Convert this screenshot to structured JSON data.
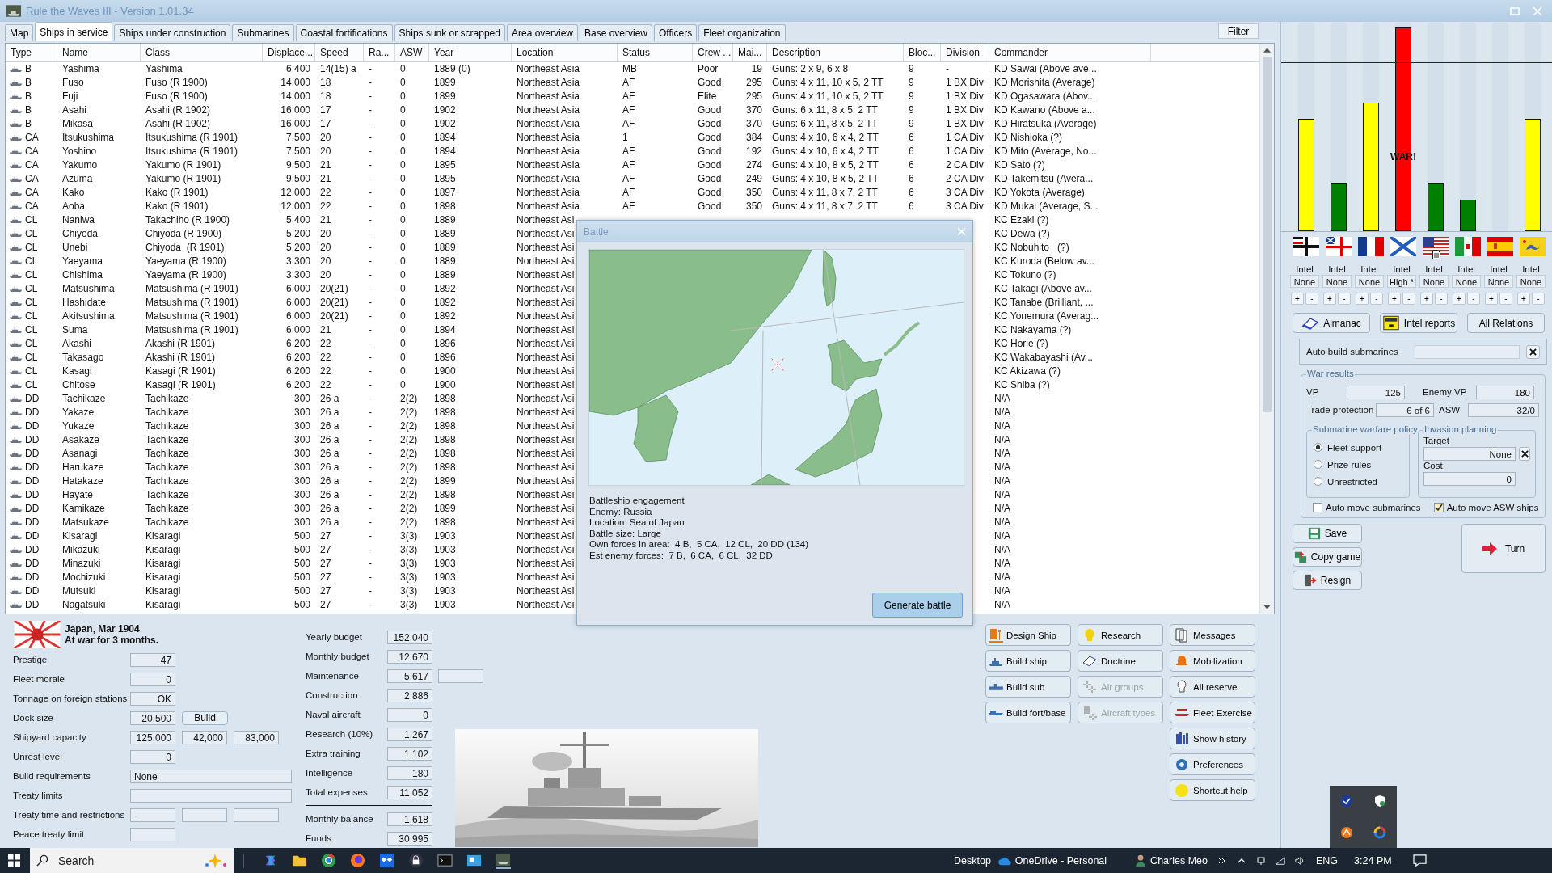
{
  "window": {
    "title": "Rule the Waves III - Version 1.01.34"
  },
  "tabs": [
    {
      "label": "Map",
      "selected": false
    },
    {
      "label": "Ships in service",
      "selected": true
    },
    {
      "label": "Ships under construction",
      "selected": false
    },
    {
      "label": "Submarines",
      "selected": false
    },
    {
      "label": "Coastal fortifications",
      "selected": false
    },
    {
      "label": "Ships sunk or scrapped",
      "selected": false
    },
    {
      "label": "Area overview",
      "selected": false
    },
    {
      "label": "Base overview",
      "selected": false
    },
    {
      "label": "Officers",
      "selected": false
    },
    {
      "label": "Fleet organization",
      "selected": false
    }
  ],
  "filter_button": "Filter",
  "table": {
    "columns": [
      "Type",
      "Name",
      "Class",
      "Displace...",
      "Speed",
      "Ra...",
      "ASW",
      "Year",
      "Location",
      "Status",
      "Crew ...",
      "Mai...",
      "Description",
      "Bloc...",
      "Division",
      "Commander"
    ],
    "rows": [
      {
        "type": "B",
        "name": "Yashima",
        "class": "Yashima",
        "displace": "6,400",
        "speed": "14(15) a",
        "ra": "-",
        "asw": "0",
        "year": "1889 (0)",
        "location": "Northeast Asia",
        "status": "MB",
        "crew": "Poor",
        "mai": "19",
        "description": "Guns: 2 x 9, 6 x 8",
        "bloc": "9",
        "division": "-",
        "commander": "KD Sawai (Above ave..."
      },
      {
        "type": "B",
        "name": "Fuso",
        "class": "Fuso (R 1900)",
        "displace": "14,000",
        "speed": "18",
        "ra": "-",
        "asw": "0",
        "year": "1899",
        "location": "Northeast Asia",
        "status": "AF",
        "crew": "Good",
        "mai": "295",
        "description": "Guns: 4 x 11, 10 x 5, 2 TT",
        "bloc": "9",
        "division": "1 BX Div",
        "commander": "KD Morishita (Average)"
      },
      {
        "type": "B",
        "name": "Fuji",
        "class": "Fuso (R 1900)",
        "displace": "14,000",
        "speed": "18",
        "ra": "-",
        "asw": "0",
        "year": "1899",
        "location": "Northeast Asia",
        "status": "AF",
        "crew": "Elite",
        "mai": "295",
        "description": "Guns: 4 x 11, 10 x 5, 2 TT",
        "bloc": "9",
        "division": "1 BX Div",
        "commander": "KD Ogasawara (Abov..."
      },
      {
        "type": "B",
        "name": "Asahi",
        "class": "Asahi (R 1902)",
        "displace": "16,000",
        "speed": "17",
        "ra": "-",
        "asw": "0",
        "year": "1902",
        "location": "Northeast Asia",
        "status": "AF",
        "crew": "Good",
        "mai": "370",
        "description": "Guns: 6 x 11, 8 x 5, 2 TT",
        "bloc": "9",
        "division": "1 BX Div",
        "commander": "KD Kawano (Above a..."
      },
      {
        "type": "B",
        "name": "Mikasa",
        "class": "Asahi (R 1902)",
        "displace": "16,000",
        "speed": "17",
        "ra": "-",
        "asw": "0",
        "year": "1902",
        "location": "Northeast Asia",
        "status": "AF",
        "crew": "Good",
        "mai": "370",
        "description": "Guns: 6 x 11, 8 x 5, 2 TT",
        "bloc": "9",
        "division": "1 BX Div",
        "commander": "KD Hiratsuka (Average)"
      },
      {
        "type": "CA",
        "name": "Itsukushima",
        "class": "Itsukushima (R 1901)",
        "displace": "7,500",
        "speed": "20",
        "ra": "-",
        "asw": "0",
        "year": "1894",
        "location": "Northeast Asia",
        "status": "1",
        "crew": "Good",
        "mai": "384",
        "description": "Guns: 4 x 10, 6 x 4, 2 TT",
        "bloc": "6",
        "division": "1 CA Div",
        "commander": "KD Nishioka (?)"
      },
      {
        "type": "CA",
        "name": "Yoshino",
        "class": "Itsukushima (R 1901)",
        "displace": "7,500",
        "speed": "20",
        "ra": "-",
        "asw": "0",
        "year": "1894",
        "location": "Northeast Asia",
        "status": "AF",
        "crew": "Good",
        "mai": "192",
        "description": "Guns: 4 x 10, 6 x 4, 2 TT",
        "bloc": "6",
        "division": "1 CA Div",
        "commander": "KD Mito (Average, No..."
      },
      {
        "type": "CA",
        "name": "Yakumo",
        "class": "Yakumo (R 1901)",
        "displace": "9,500",
        "speed": "21",
        "ra": "-",
        "asw": "0",
        "year": "1895",
        "location": "Northeast Asia",
        "status": "AF",
        "crew": "Good",
        "mai": "274",
        "description": "Guns: 4 x 10, 8 x 5, 2 TT",
        "bloc": "6",
        "division": "2 CA Div",
        "commander": "KD Sato (?)"
      },
      {
        "type": "CA",
        "name": "Azuma",
        "class": "Yakumo (R 1901)",
        "displace": "9,500",
        "speed": "21",
        "ra": "-",
        "asw": "0",
        "year": "1895",
        "location": "Northeast Asia",
        "status": "AF",
        "crew": "Good",
        "mai": "249",
        "description": "Guns: 4 x 10, 8 x 5, 2 TT",
        "bloc": "6",
        "division": "2 CA Div",
        "commander": "KD Takemitsu (Avera..."
      },
      {
        "type": "CA",
        "name": "Kako",
        "class": "Kako (R 1901)",
        "displace": "12,000",
        "speed": "22",
        "ra": "-",
        "asw": "0",
        "year": "1897",
        "location": "Northeast Asia",
        "status": "AF",
        "crew": "Good",
        "mai": "350",
        "description": "Guns: 4 x 11, 8 x 7, 2 TT",
        "bloc": "6",
        "division": "3 CA Div",
        "commander": "KD Yokota (Average)"
      },
      {
        "type": "CA",
        "name": "Aoba",
        "class": "Kako (R 1901)",
        "displace": "12,000",
        "speed": "22",
        "ra": "-",
        "asw": "0",
        "year": "1898",
        "location": "Northeast Asia",
        "status": "AF",
        "crew": "Good",
        "mai": "350",
        "description": "Guns: 4 x 11, 8 x 7, 2 TT",
        "bloc": "6",
        "division": "3 CA Div",
        "commander": "KD Mukai (Average, S..."
      },
      {
        "type": "CL",
        "name": "Naniwa",
        "class": "Takachiho (R 1900)",
        "displace": "5,400",
        "speed": "21",
        "ra": "-",
        "asw": "0",
        "year": "1889",
        "location": "Northeast Asi",
        "commander": "KC Ezaki (?)"
      },
      {
        "type": "CL",
        "name": "Chiyoda",
        "class": "Chiyoda (R 1900)",
        "displace": "5,200",
        "speed": "20",
        "ra": "-",
        "asw": "0",
        "year": "1889",
        "location": "Northeast Asi",
        "commander": "KC Dewa (?)"
      },
      {
        "type": "CL",
        "name": "Unebi",
        "class": "Chiyoda  (R 1901)",
        "displace": "5,200",
        "speed": "20",
        "ra": "-",
        "asw": "0",
        "year": "1889",
        "location": "Northeast Asi",
        "commander": "KC Nobuhito   (?)"
      },
      {
        "type": "CL",
        "name": "Yaeyama",
        "class": "Yaeyama (R 1900)",
        "displace": "3,300",
        "speed": "20",
        "ra": "-",
        "asw": "0",
        "year": "1889",
        "location": "Northeast Asi",
        "commander": "KC Kuroda (Below av..."
      },
      {
        "type": "CL",
        "name": "Chishima",
        "class": "Yaeyama (R 1900)",
        "displace": "3,300",
        "speed": "20",
        "ra": "-",
        "asw": "0",
        "year": "1889",
        "location": "Northeast Asi",
        "commander": "KC Tokuno (?)"
      },
      {
        "type": "CL",
        "name": "Matsushima",
        "class": "Matsushima (R 1901)",
        "displace": "6,000",
        "speed": "20(21)",
        "ra": "-",
        "asw": "0",
        "year": "1892",
        "location": "Northeast Asi",
        "commander": "KC Takagi (Above av..."
      },
      {
        "type": "CL",
        "name": "Hashidate",
        "class": "Matsushima (R 1901)",
        "displace": "6,000",
        "speed": "20(21)",
        "ra": "-",
        "asw": "0",
        "year": "1892",
        "location": "Northeast Asi",
        "commander": "KC Tanabe (Brilliant, ..."
      },
      {
        "type": "CL",
        "name": "Akitsushima",
        "class": "Matsushima (R 1901)",
        "displace": "6,000",
        "speed": "20(21)",
        "ra": "-",
        "asw": "0",
        "year": "1892",
        "location": "Northeast Asi",
        "commander": "KC Yonemura (Averag..."
      },
      {
        "type": "CL",
        "name": "Suma",
        "class": "Matsushima (R 1901)",
        "displace": "6,000",
        "speed": "21",
        "ra": "-",
        "asw": "0",
        "year": "1894",
        "location": "Northeast Asi",
        "commander": "KC Nakayama (?)"
      },
      {
        "type": "CL",
        "name": "Akashi",
        "class": "Akashi (R 1901)",
        "displace": "6,200",
        "speed": "22",
        "ra": "-",
        "asw": "0",
        "year": "1896",
        "location": "Northeast Asi",
        "commander": "KC Horie (?)"
      },
      {
        "type": "CL",
        "name": "Takasago",
        "class": "Akashi (R 1901)",
        "displace": "6,200",
        "speed": "22",
        "ra": "-",
        "asw": "0",
        "year": "1896",
        "location": "Northeast Asi",
        "commander": "KC Wakabayashi (Av..."
      },
      {
        "type": "CL",
        "name": "Kasagi",
        "class": "Kasagi (R 1901)",
        "displace": "6,200",
        "speed": "22",
        "ra": "-",
        "asw": "0",
        "year": "1900",
        "location": "Northeast Asi",
        "commander": "KC Akizawa (?)"
      },
      {
        "type": "CL",
        "name": "Chitose",
        "class": "Kasagi (R 1901)",
        "displace": "6,200",
        "speed": "22",
        "ra": "-",
        "asw": "0",
        "year": "1900",
        "location": "Northeast Asi",
        "commander": "KC Shiba (?)"
      },
      {
        "type": "DD",
        "name": "Tachikaze",
        "class": "Tachikaze",
        "displace": "300",
        "speed": "26 a",
        "ra": "-",
        "asw": "2(2)",
        "year": "1898",
        "location": "Northeast Asi",
        "commander": "N/A"
      },
      {
        "type": "DD",
        "name": "Yakaze",
        "class": "Tachikaze",
        "displace": "300",
        "speed": "26 a",
        "ra": "-",
        "asw": "2(2)",
        "year": "1898",
        "location": "Northeast Asi",
        "commander": "N/A"
      },
      {
        "type": "DD",
        "name": "Yukaze",
        "class": "Tachikaze",
        "displace": "300",
        "speed": "26 a",
        "ra": "-",
        "asw": "2(2)",
        "year": "1898",
        "location": "Northeast Asi",
        "commander": "N/A"
      },
      {
        "type": "DD",
        "name": "Asakaze",
        "class": "Tachikaze",
        "displace": "300",
        "speed": "26 a",
        "ra": "-",
        "asw": "2(2)",
        "year": "1898",
        "location": "Northeast Asi",
        "commander": "N/A"
      },
      {
        "type": "DD",
        "name": "Asanagi",
        "class": "Tachikaze",
        "displace": "300",
        "speed": "26 a",
        "ra": "-",
        "asw": "2(2)",
        "year": "1898",
        "location": "Northeast Asi",
        "commander": "N/A"
      },
      {
        "type": "DD",
        "name": "Harukaze",
        "class": "Tachikaze",
        "displace": "300",
        "speed": "26 a",
        "ra": "-",
        "asw": "2(2)",
        "year": "1898",
        "location": "Northeast Asi",
        "commander": "N/A"
      },
      {
        "type": "DD",
        "name": "Hatakaze",
        "class": "Tachikaze",
        "displace": "300",
        "speed": "26 a",
        "ra": "-",
        "asw": "2(2)",
        "year": "1899",
        "location": "Northeast Asi",
        "commander": "N/A"
      },
      {
        "type": "DD",
        "name": "Hayate",
        "class": "Tachikaze",
        "displace": "300",
        "speed": "26 a",
        "ra": "-",
        "asw": "2(2)",
        "year": "1898",
        "location": "Northeast Asi",
        "commander": "N/A"
      },
      {
        "type": "DD",
        "name": "Kamikaze",
        "class": "Tachikaze",
        "displace": "300",
        "speed": "26 a",
        "ra": "-",
        "asw": "2(2)",
        "year": "1899",
        "location": "Northeast Asi",
        "commander": "N/A"
      },
      {
        "type": "DD",
        "name": "Matsukaze",
        "class": "Tachikaze",
        "displace": "300",
        "speed": "26 a",
        "ra": "-",
        "asw": "2(2)",
        "year": "1898",
        "location": "Northeast Asi",
        "commander": "N/A"
      },
      {
        "type": "DD",
        "name": "Kisaragi",
        "class": "Kisaragi",
        "displace": "500",
        "speed": "27",
        "ra": "-",
        "asw": "3(3)",
        "year": "1903",
        "location": "Northeast Asi",
        "commander": "N/A"
      },
      {
        "type": "DD",
        "name": "Mikazuki",
        "class": "Kisaragi",
        "displace": "500",
        "speed": "27",
        "ra": "-",
        "asw": "3(3)",
        "year": "1903",
        "location": "Northeast Asi",
        "commander": "N/A"
      },
      {
        "type": "DD",
        "name": "Minazuki",
        "class": "Kisaragi",
        "displace": "500",
        "speed": "27",
        "ra": "-",
        "asw": "3(3)",
        "year": "1903",
        "location": "Northeast Asi",
        "commander": "N/A"
      },
      {
        "type": "DD",
        "name": "Mochizuki",
        "class": "Kisaragi",
        "displace": "500",
        "speed": "27",
        "ra": "-",
        "asw": "3(3)",
        "year": "1903",
        "location": "Northeast Asi",
        "commander": "N/A"
      },
      {
        "type": "DD",
        "name": "Mutsuki",
        "class": "Kisaragi",
        "displace": "500",
        "speed": "27",
        "ra": "-",
        "asw": "3(3)",
        "year": "1903",
        "location": "Northeast Asi",
        "commander": "N/A"
      },
      {
        "type": "DD",
        "name": "Nagatsuki",
        "class": "Kisaragi",
        "displace": "500",
        "speed": "27",
        "ra": "-",
        "asw": "3(3)",
        "year": "1903",
        "location": "Northeast Asi",
        "commander": "N/A"
      }
    ]
  },
  "battle_dialog": {
    "title": "Battle",
    "lines": [
      "Battleship engagement",
      "Enemy: Russia",
      "Location: Sea of Japan",
      "Battle size: Large",
      "Own forces in area:  4 B,  5 CA,  12 CL,  20 DD (134)",
      "Est enemy forces:  7 B,  6 CA,  6 CL,  32 DD"
    ],
    "button": "Generate battle"
  },
  "nation": {
    "title": "Japan, Mar 1904",
    "subtitle": "At war for 3 months."
  },
  "stats": [
    {
      "label": "Prestige",
      "kind": "single",
      "values": [
        "47"
      ]
    },
    {
      "label": "Fleet morale",
      "kind": "single",
      "values": [
        "0"
      ]
    },
    {
      "label": "Tonnage on foreign stations",
      "kind": "single",
      "values": [
        "OK"
      ]
    },
    {
      "label": "Dock size",
      "kind": "button",
      "values": [
        "20,500"
      ],
      "button": "Build"
    },
    {
      "label": "Shipyard capacity",
      "kind": "triple",
      "values": [
        "125,000",
        "42,000",
        "83,000"
      ]
    },
    {
      "label": "Unrest level",
      "kind": "single",
      "values": [
        "0"
      ]
    },
    {
      "label": "Build requirements",
      "kind": "wide",
      "values": [
        "None"
      ]
    },
    {
      "label": "Treaty limits",
      "kind": "wide"
    },
    {
      "label": "Treaty time and restrictions",
      "kind": "triple",
      "values": [
        "-"
      ]
    },
    {
      "label": "Peace treaty limit",
      "kind": "single"
    }
  ],
  "budget": [
    {
      "label": "Yearly budget",
      "value": "152,040"
    },
    {
      "label": "Monthly budget",
      "value": "12,670"
    },
    {
      "label": "Maintenance",
      "value": "5,617",
      "kind": "double"
    },
    {
      "label": "Construction",
      "value": "2,886"
    },
    {
      "label": "Naval aircraft",
      "value": "0"
    },
    {
      "label": "Research (10%)",
      "value": "1,267"
    },
    {
      "label": "Extra training",
      "value": "1,102"
    },
    {
      "label": "Intelligence",
      "value": "180"
    },
    {
      "label": "Total expenses",
      "value": "11,052"
    }
  ],
  "balance": [
    {
      "label": "Monthly balance",
      "value": "1,618"
    },
    {
      "label": "Funds",
      "value": "30,995"
    }
  ],
  "commands": [
    [
      {
        "label": "Design Ship",
        "kind": "design",
        "disabled": false
      },
      {
        "label": "Build ship",
        "kind": "ship",
        "disabled": false
      },
      {
        "label": "Build sub",
        "kind": "sub",
        "disabled": false
      },
      {
        "label": "Build fort/base",
        "kind": "fort",
        "disabled": false
      }
    ],
    [
      {
        "label": "Research",
        "kind": "research",
        "disabled": false
      },
      {
        "label": "Doctrine",
        "kind": "doctrine",
        "disabled": false
      },
      {
        "label": "Air groups",
        "kind": "air",
        "disabled": true
      },
      {
        "label": "Aircraft types",
        "kind": "aircraft",
        "disabled": true
      }
    ],
    [
      {
        "label": "Messages",
        "kind": "messages",
        "disabled": false
      },
      {
        "label": "Mobilization",
        "kind": "bell",
        "disabled": false
      },
      {
        "label": "All reserve",
        "kind": "reserve",
        "disabled": false
      },
      {
        "label": "Fleet Exercise",
        "kind": "exercise",
        "disabled": false
      },
      {
        "label": "Show history",
        "kind": "history",
        "disabled": false
      },
      {
        "label": "Preferences",
        "kind": "gear",
        "disabled": false
      },
      {
        "label": "Shortcut help",
        "kind": "help",
        "disabled": false
      }
    ]
  ],
  "nations": [
    {
      "level": 0.54,
      "color": "#ffff00",
      "intel_label": "Intel",
      "intel": "None",
      "report": false,
      "buttons": [
        "+",
        "-"
      ]
    },
    {
      "level": 0.23,
      "color": "#008000",
      "intel_label": "Intel",
      "intel": "None",
      "report": false,
      "buttons": [
        "+",
        "-"
      ]
    },
    {
      "level": 0.62,
      "color": "#ffff00",
      "intel_label": "Intel",
      "intel": "None",
      "report": false,
      "buttons": [
        "+",
        "-"
      ]
    },
    {
      "level": 0.98,
      "color": "#ff0000",
      "label": "WAR!",
      "intel_label": "Intel",
      "intel": "High *",
      "report": false,
      "buttons": [
        "+",
        "-"
      ]
    },
    {
      "level": 0.23,
      "color": "#008000",
      "intel_label": "Intel",
      "intel": "None",
      "report": true,
      "buttons": [
        "+",
        "-"
      ]
    },
    {
      "level": 0.15,
      "color": "#008000",
      "intel_label": "Intel",
      "intel": "None",
      "report": false,
      "buttons": [
        "+",
        "-"
      ]
    },
    {
      "intel_label": "Intel",
      "intel": "None",
      "report": false,
      "buttons": [
        "+",
        "-"
      ]
    },
    {
      "level": 0.54,
      "color": "#ffff00",
      "intel_label": "Intel",
      "intel": "None",
      "report": false,
      "buttons": [
        "+",
        "-"
      ]
    }
  ],
  "relation_buttons": [
    {
      "label": "Almanac",
      "kind": "book"
    },
    {
      "label": "Intel reports",
      "kind": "cabinet"
    },
    {
      "label": "All Relations",
      "kind": "plain"
    }
  ],
  "auto_build": {
    "label": "Auto build submarines"
  },
  "war_results": {
    "legend": "War results",
    "vp_label": "VP",
    "vp": "125",
    "enemy_vp_label": "Enemy VP",
    "enemy_vp": "180",
    "trade_label": "Trade protection",
    "trade": "6 of 6",
    "asw_label": "ASW",
    "asw": "32/0"
  },
  "submarine_policy": {
    "legend": "Submarine warfare policy",
    "options": [
      {
        "label": "Fleet support",
        "selected": true
      },
      {
        "label": "Prize rules",
        "selected": false
      },
      {
        "label": "Unrestricted",
        "selected": false
      }
    ]
  },
  "invasion": {
    "legend": "Invasion planning",
    "target_label": "Target",
    "target": "None",
    "cost_label": "Cost",
    "cost": "0"
  },
  "checkboxes": [
    {
      "label": "Auto move submarines",
      "checked": false
    },
    {
      "label": "Auto move ASW ships",
      "checked": true
    }
  ],
  "game_buttons": [
    {
      "label": "Save",
      "kind": "save"
    },
    {
      "label": "Copy game",
      "kind": "copy"
    },
    {
      "label": "Resign",
      "kind": "resign"
    }
  ],
  "turn_button": "Turn",
  "taskbar": {
    "search_placeholder": "Search",
    "items": [
      "Desktop",
      "OneDrive - Personal",
      "Charles Meo"
    ],
    "language": "ENG",
    "time": "3:24 PM"
  }
}
